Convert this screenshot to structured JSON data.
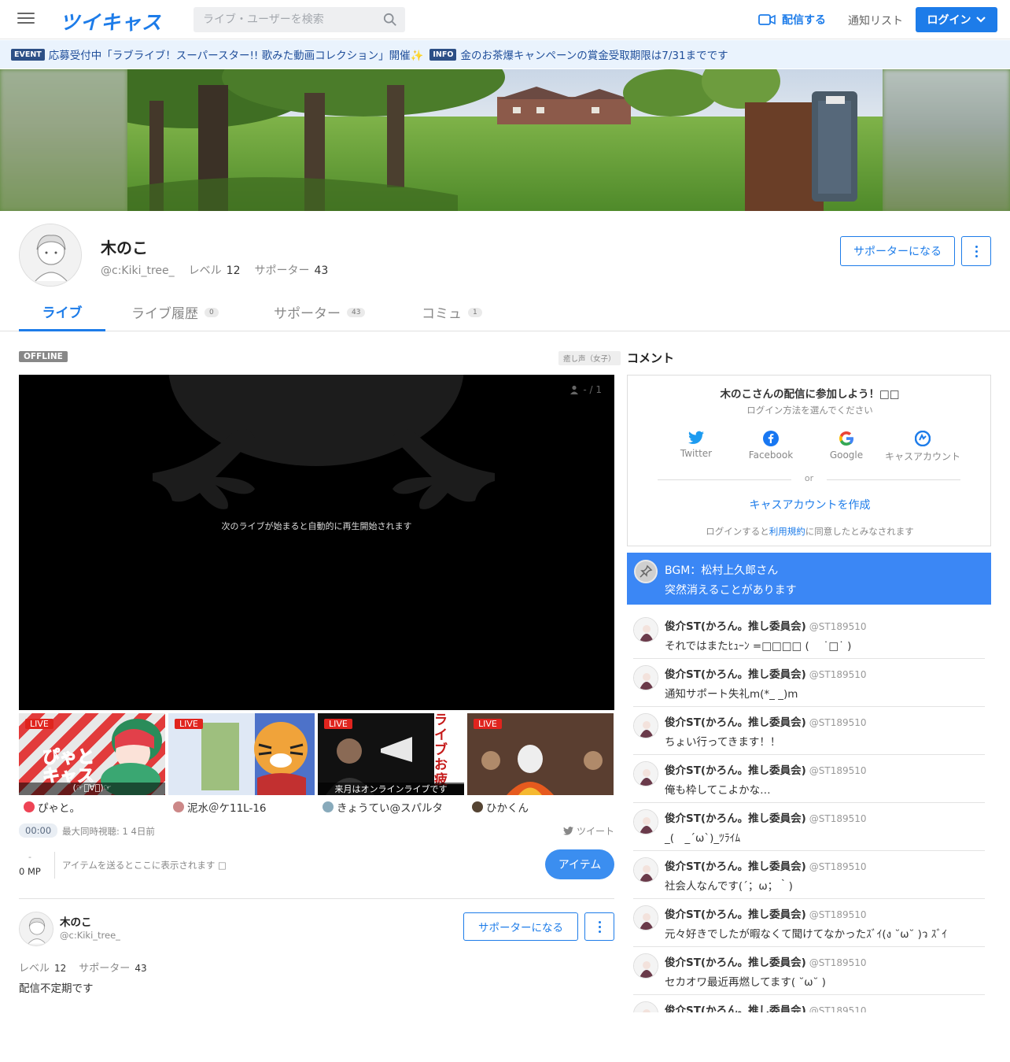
{
  "header": {
    "logo": "ツイキャス",
    "search_placeholder": "ライブ・ユーザーを検索",
    "broadcast_label": "配信する",
    "notify_label": "通知リスト",
    "login_label": "ログイン"
  },
  "event_bar": {
    "event_tag": "EVENT",
    "event_text": "応募受付中「ラブライブ！スーパースター!! 歌みた動画コレクション」開催✨",
    "info_tag": "INFO",
    "info_text": "金のお茶爆キャンペーンの賞金受取期限は7/31までです"
  },
  "profile": {
    "name": "木のこ",
    "id": "@c:Kiki_tree_",
    "level_label": "レベル",
    "level": "12",
    "supporter_label": "サポーター",
    "supporters": "43",
    "supporter_button": "サポーターになる"
  },
  "tabs": [
    {
      "label": "ライブ",
      "count": ""
    },
    {
      "label": "ライブ履歴",
      "count": "0"
    },
    {
      "label": "サポーター",
      "count": "43"
    },
    {
      "label": "コミュ",
      "count": "1"
    }
  ],
  "player": {
    "status": "OFFLINE",
    "category": "癒し声（女子）",
    "viewers": "- / 1",
    "message": "次のライブが始まると自動的に再生開始されます"
  },
  "live_thumbs": [
    {
      "badge": "LIVE",
      "name": "ぴゃと。",
      "overlay": "(☞ﾟ∀ﾟ)☞",
      "image_text": "ぴゃと キャス"
    },
    {
      "badge": "LIVE",
      "name": "泥水＠ケ11L-16",
      "overlay": "",
      "image_text": ""
    },
    {
      "badge": "LIVE",
      "name": "きょうてい@スパルタ",
      "overlay": "来月はオンラインライブです",
      "image_text": "ライブお疲"
    },
    {
      "badge": "LIVE",
      "name": "ひかくん",
      "overlay": "",
      "image_text": ""
    }
  ],
  "stream_meta": {
    "time": "00:00",
    "text": "最大同時視聴: 1  4日前",
    "tweet": "ツイート"
  },
  "items": {
    "mp_dash": "-",
    "mp": "0 MP",
    "message": "アイテムを送るとここに表示されます □",
    "button": "アイテム"
  },
  "profile_card": {
    "bio": "配信不定期です"
  },
  "comments_panel": {
    "heading": "コメント",
    "join_title": "木のこさんの配信に参加しよう！□□",
    "join_sub": "ログイン方法を選んでください",
    "sns": [
      {
        "label": "Twitter",
        "icon": "twitter-icon"
      },
      {
        "label": "Facebook",
        "icon": "facebook-icon"
      },
      {
        "label": "Google",
        "icon": "google-icon"
      },
      {
        "label": "キャスアカウント",
        "icon": "cas-account-icon"
      }
    ],
    "or": "or",
    "create_account": "キャスアカウントを作成",
    "terms_before": "ログインすると",
    "terms_link": "利用規約",
    "terms_after": "に同意したとみなされます",
    "pinned_line1": "BGM：松村上久郎さん",
    "pinned_line2": "突然消えることがあります"
  },
  "comments": [
    {
      "name": "俊介ST(かろん。推し委員会)",
      "id": "@ST189510",
      "text": "それではまたﾋｭｰﾝ =□□□□ (　 ˙□˙ )"
    },
    {
      "name": "俊介ST(かろん。推し委員会)",
      "id": "@ST189510",
      "text": "通知サポート失礼m(*_ _)m"
    },
    {
      "name": "俊介ST(かろん。推し委員会)",
      "id": "@ST189510",
      "text": "ちょい行ってきます！！"
    },
    {
      "name": "俊介ST(かろん。推し委員会)",
      "id": "@ST189510",
      "text": "俺も枠してこよかな…"
    },
    {
      "name": "俊介ST(かろん。推し委員会)",
      "id": "@ST189510",
      "text": "_(　_´ω`)_ﾂﾗｲﾑ"
    },
    {
      "name": "俊介ST(かろん。推し委員会)",
      "id": "@ST189510",
      "text": "社会人なんです(´；ω；｀)"
    },
    {
      "name": "俊介ST(かろん。推し委員会)",
      "id": "@ST189510",
      "text": "元々好きでしたが暇なくて聞けてなかったｽﾞｲ(ง ˘ω˘ )ว ｽﾞｲ"
    },
    {
      "name": "俊介ST(かろん。推し委員会)",
      "id": "@ST189510",
      "text": "セカオワ最近再燃してます( ˘ω˘ )"
    },
    {
      "name": "俊介ST(かろん。推し委員会)",
      "id": "@ST189510",
      "text": ""
    }
  ],
  "colors": {
    "brand": "#1d7ce9",
    "pinned_bg": "#3b87f5",
    "live_red": "#e0241e"
  }
}
